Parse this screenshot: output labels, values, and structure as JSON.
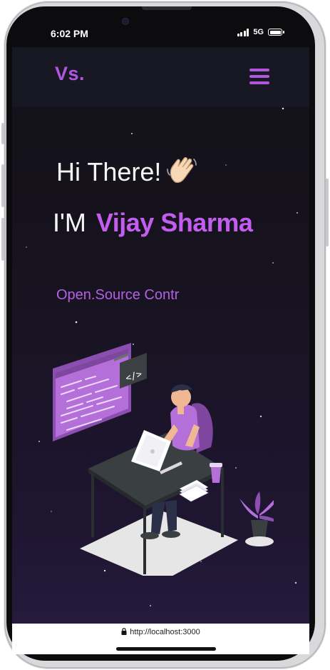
{
  "status_bar": {
    "time": "6:02 PM",
    "network": "5G"
  },
  "navbar": {
    "logo": "Vs.",
    "menu_icon": "hamburger-menu-icon"
  },
  "hero": {
    "greeting": "Hi There!",
    "greeting_emoji_icon": "waving-hand-icon",
    "intro_prefix": "I'M",
    "name": "Vijay Sharma",
    "role_typed": "Open.Source Contr",
    "illustration": "developer-at-desk-illustration"
  },
  "browser": {
    "url": "http://localhost:3000",
    "lock_icon": "lock-icon"
  },
  "colors": {
    "accent": "#b057e0",
    "name_accent": "#c25df0",
    "background_top": "#121118",
    "background_bottom": "#241a3b",
    "navbar": "#181824"
  }
}
